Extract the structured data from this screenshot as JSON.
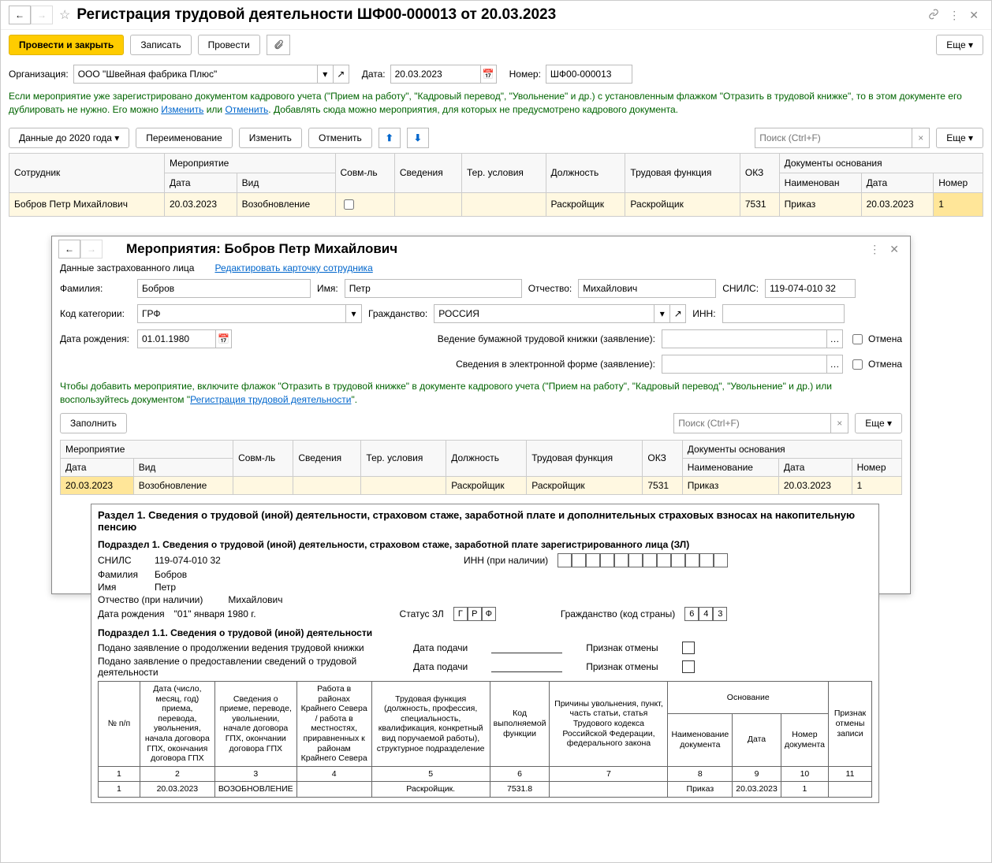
{
  "header": {
    "title": "Регистрация трудовой деятельности ШФ00-000013 от 20.03.2023"
  },
  "toolbar": {
    "submit_close": "Провести и закрыть",
    "write": "Записать",
    "submit": "Провести",
    "more": "Еще"
  },
  "form": {
    "org_label": "Организация:",
    "org_value": "ООО \"Швейная фабрика Плюс\"",
    "date_label": "Дата:",
    "date_value": "20.03.2023",
    "number_label": "Номер:",
    "number_value": "ШФ00-000013"
  },
  "info": {
    "text_part1": "Если мероприятие уже зарегистрировано документом кадрового учета (\"Прием на работу\", \"Кадровый перевод\", \"Увольнение\" и др.) с установленным флажком \"Отразить в трудовой книжке\", то в этом документе его дублировать не нужно. Его можно ",
    "link_change": "Изменить",
    "text_or": " или ",
    "link_cancel": "Отменить",
    "text_part2": ". Добавлять сюда можно мероприятия, для которых не предусмотрено кадрового документа."
  },
  "toolbar2": {
    "data_before": "Данные до 2020 года",
    "rename": "Переименование",
    "change": "Изменить",
    "cancel": "Отменить",
    "search_placeholder": "Поиск (Ctrl+F)",
    "more": "Еще"
  },
  "grid1": {
    "cols": {
      "employee": "Сотрудник",
      "event": "Мероприятие",
      "date": "Дата",
      "kind": "Вид",
      "combine": "Совм-ль",
      "info": "Сведения",
      "conditions": "Тер. условия",
      "position": "Должность",
      "function": "Трудовая функция",
      "okz": "ОКЗ",
      "docs": "Документы основания",
      "doc_name": "Наименован",
      "doc_date": "Дата",
      "doc_num": "Номер"
    },
    "row": {
      "employee": "Бобров Петр Михайлович",
      "date": "20.03.2023",
      "kind": "Возобновление",
      "position": "Раскройщик",
      "function": "Раскройщик",
      "okz": "7531",
      "doc_name": "Приказ",
      "doc_date": "20.03.2023",
      "doc_num": "1"
    }
  },
  "dialog": {
    "title": "Мероприятия: Бобров Петр Михайлович",
    "insured_label": "Данные застрахованного лица",
    "edit_link": "Редактировать карточку сотрудника",
    "fam_label": "Фамилия:",
    "fam_value": "Бобров",
    "name_label": "Имя:",
    "name_value": "Петр",
    "patr_label": "Отчество:",
    "patr_value": "Михайлович",
    "snils_label": "СНИЛС:",
    "snils_value": "119-074-010 32",
    "cat_label": "Код категории:",
    "cat_value": "ГРФ",
    "citizen_label": "Гражданство:",
    "citizen_value": "РОССИЯ",
    "inn_label": "ИНН:",
    "inn_value": "",
    "dob_label": "Дата рождения:",
    "dob_value": "01.01.1980",
    "paper_label": "Ведение бумажной трудовой книжки (заявление):",
    "electronic_label": "Сведения в электронной форме (заявление):",
    "cancel_label": "Отмена",
    "hint_text": "Чтобы добавить мероприятие, включите флажок \"Отразить в трудовой книжке\" в документе кадрового учета (\"Прием на работу\", \"Кадровый перевод\", \"Увольнение\" и др.) или воспользуйтесь документом \"",
    "hint_link": "Регистрация трудовой деятельности",
    "hint_end": "\".",
    "fill": "Заполнить",
    "search_placeholder": "Поиск (Ctrl+F)",
    "more": "Еще"
  },
  "grid2": {
    "cols": {
      "event": "Мероприятие",
      "date": "Дата",
      "kind": "Вид",
      "combine": "Совм-ль",
      "info": "Сведения",
      "conditions": "Тер. условия",
      "position": "Должность",
      "function": "Трудовая функция",
      "okz": "ОКЗ",
      "docs": "Документы основания",
      "doc_name": "Наименование",
      "doc_date": "Дата",
      "doc_num": "Номер"
    },
    "row": {
      "date": "20.03.2023",
      "kind": "Возобновление",
      "position": "Раскройщик",
      "function": "Раскройщик",
      "okz": "7531",
      "doc_name": "Приказ",
      "doc_date": "20.03.2023",
      "doc_num": "1"
    }
  },
  "report": {
    "section1_title": "Раздел 1. Сведения о трудовой (иной) деятельности, страховом стаже, заработной плате и дополнительных страховых взносах на накопительную пенсию",
    "sub1_title": "Подраздел 1. Сведения о трудовой (иной) деятельности, страховом стаже, заработной плате зарегистрированного лица (ЗЛ)",
    "snils_label": "СНИЛС",
    "snils_value": "119-074-010 32",
    "inn_label": "ИНН (при наличии)",
    "fam_label": "Фамилия",
    "fam_value": "Бобров",
    "name_label": "Имя",
    "name_value": "Петр",
    "patr_label": "Отчество (при наличии)",
    "patr_value": "Михайлович",
    "dob_label": "Дата рождения",
    "dob_value": "\"01\" января 1980 г.",
    "status_label": "Статус ЗЛ",
    "status_chars": [
      "Г",
      "Р",
      "Ф"
    ],
    "citizen_label": "Гражданство (код страны)",
    "citizen_chars": [
      "6",
      "4",
      "3"
    ],
    "sub11_title": "Подраздел 1.1. Сведения о трудовой (иной) деятельности",
    "app_paper": "Подано заявление о продолжении ведения трудовой книжки",
    "app_electronic": "Подано заявление о предоставлении сведений о трудовой деятельности",
    "date_submit": "Дата подачи",
    "cancel_flag": "Признак отмены",
    "rtable": {
      "h_num": "№ п/п",
      "h_date": "Дата (число, месяц, год) приема, перевода, увольнения, начала договора ГПХ, окончания договора ГПХ",
      "h_info": "Сведения о приеме, переводе, увольнении, начале договора ГПХ, окончании договора ГПХ",
      "h_north": "Работа в районах Крайнего Севера / работа в местностях, приравненных к районам Крайнего Севера",
      "h_func": "Трудовая функция (должность, профессия, специальность, квалификация, конкретный вид поручаемой работы), структурное подразделение",
      "h_code": "Код выполняемой функции",
      "h_reason": "Причины увольнения, пункт, часть статьи, статья Трудового кодекса Российской Федерации, федерального закона",
      "h_basis": "Основание",
      "h_docname": "Наименование документа",
      "h_docdate": "Дата",
      "h_docnum": "Номер документа",
      "h_cancel": "Признак отмены записи",
      "n1": "1",
      "n2": "2",
      "n3": "3",
      "n4": "4",
      "n5": "5",
      "n6": "6",
      "n7": "7",
      "n8": "8",
      "n9": "9",
      "n10": "10",
      "n11": "11",
      "row_num": "1",
      "row_date": "20.03.2023",
      "row_info": "ВОЗОБНОВЛЕНИЕ",
      "row_func": "Раскройщик.",
      "row_code": "7531.8",
      "row_docname": "Приказ",
      "row_docdate": "20.03.2023",
      "row_docnum": "1"
    }
  }
}
